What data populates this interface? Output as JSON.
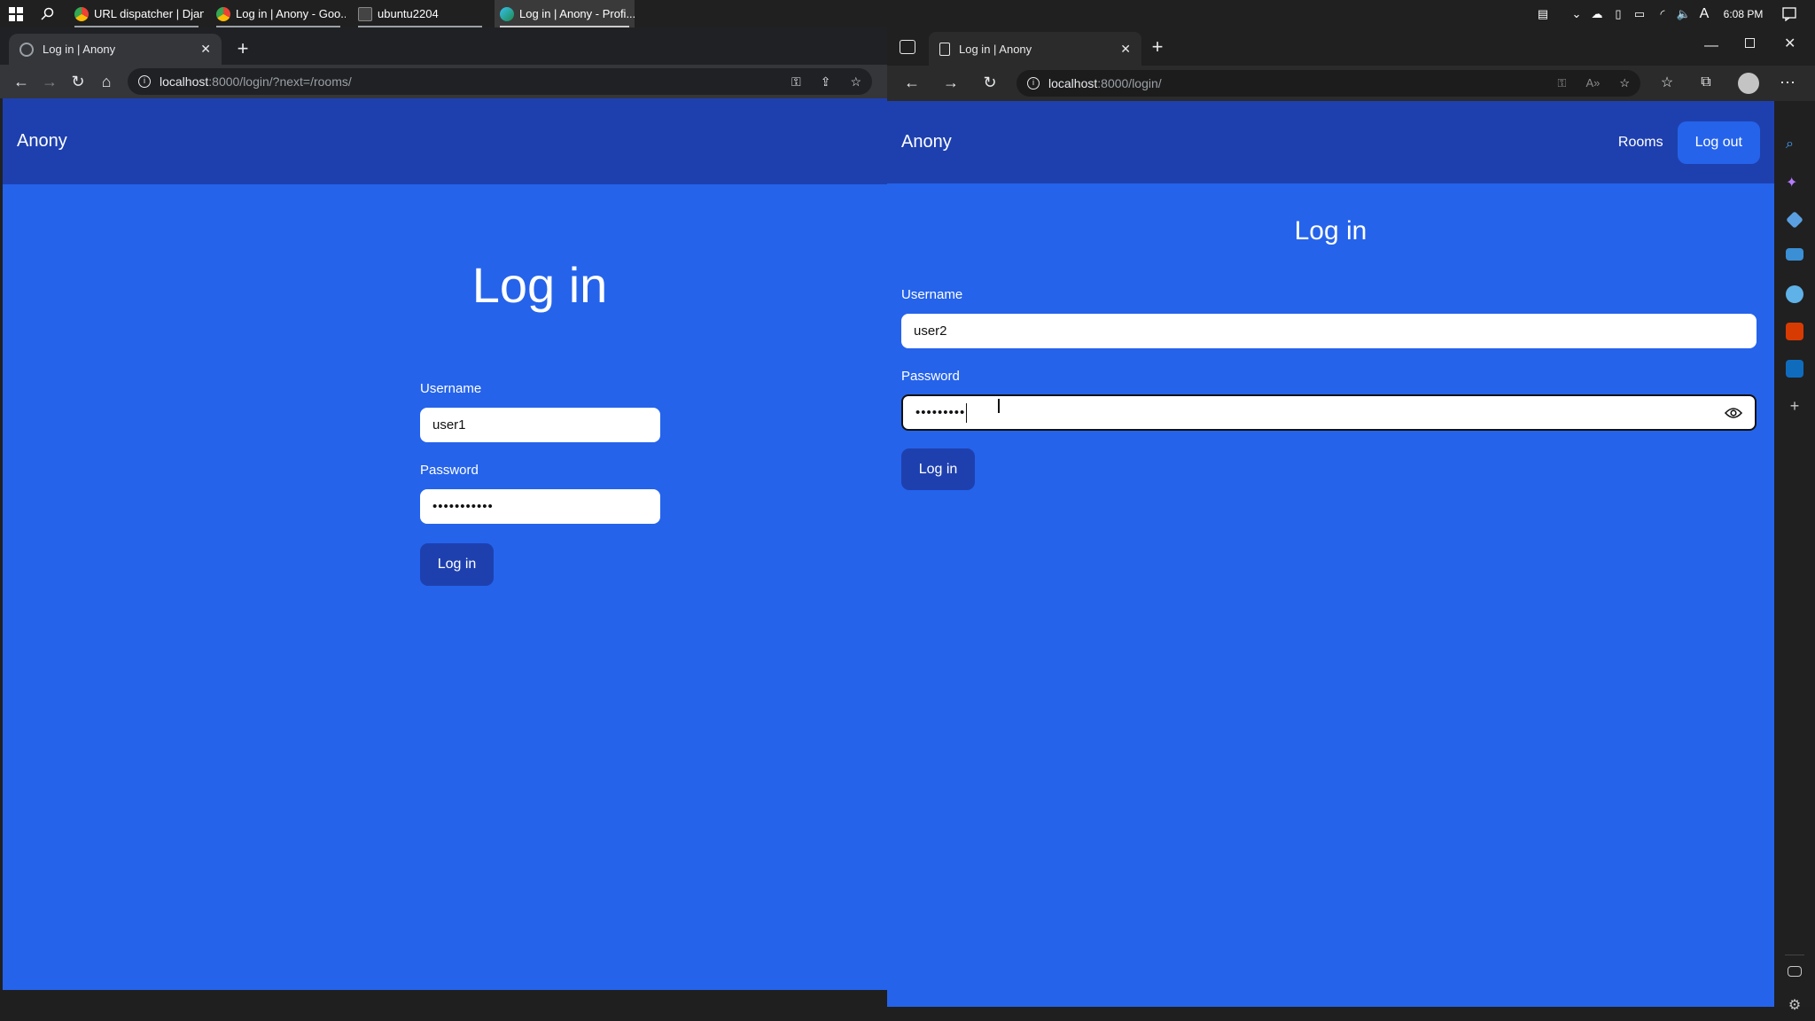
{
  "taskbar": {
    "items": [
      {
        "label": "URL dispatcher | Djan..."
      },
      {
        "label": "Log in | Anony - Goo..."
      },
      {
        "label": "ubuntu2204"
      },
      {
        "label": "Log in | Anony - Profi..."
      }
    ],
    "clock": "6:08 PM"
  },
  "chrome": {
    "tab_title": "Log in | Anony",
    "url_host": "localhost",
    "url_rest": ":8000/login/?next=/rooms/",
    "page": {
      "brand": "Anony",
      "heading": "Log in",
      "username_label": "Username",
      "username_value": "user1",
      "password_label": "Password",
      "password_value": "•••••••••••",
      "submit_label": "Log in"
    }
  },
  "edge": {
    "tab_title": "Log in | Anony",
    "url_host": "localhost",
    "url_rest": ":8000/login/",
    "page": {
      "brand": "Anony",
      "nav_rooms": "Rooms",
      "nav_logout": "Log out",
      "heading": "Log in",
      "username_label": "Username",
      "username_value": "user2",
      "password_label": "Password",
      "password_value": "•••••••••",
      "submit_label": "Log in"
    }
  },
  "colors": {
    "page_bg": "#2563eb",
    "navbar_bg": "#1e40af",
    "button_bg": "#1e40af",
    "logout_bg": "#2563eb"
  }
}
